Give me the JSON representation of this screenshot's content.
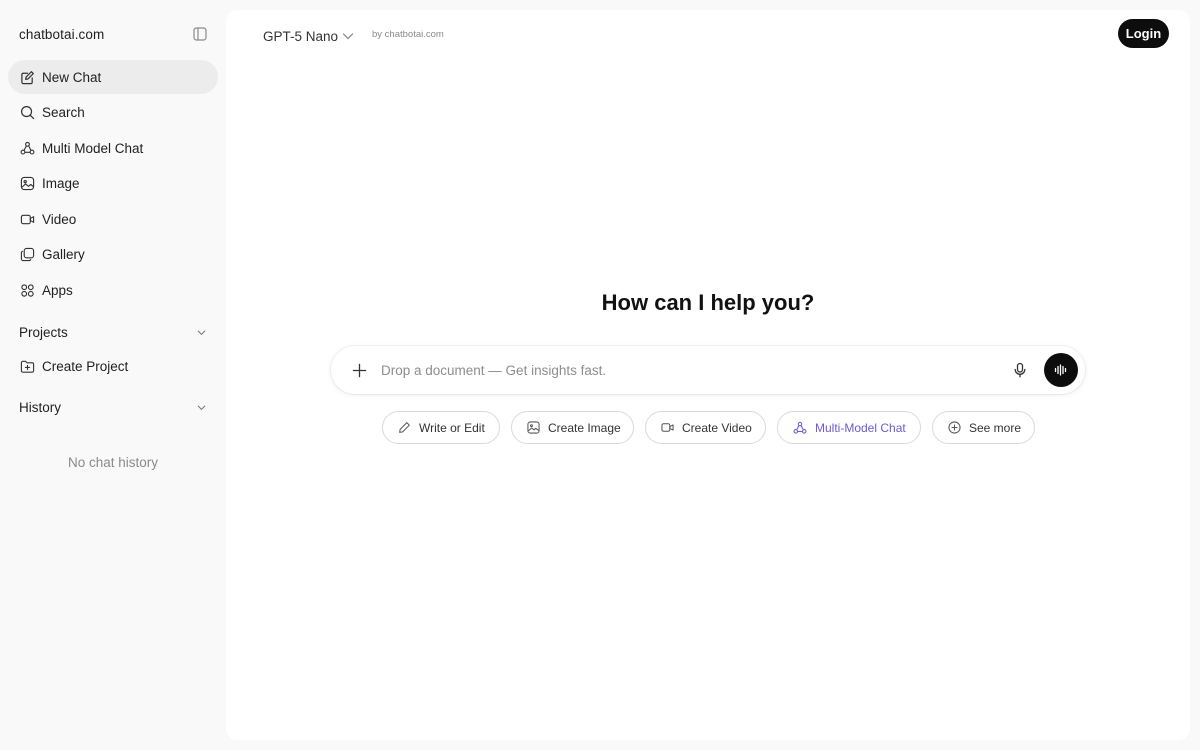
{
  "sidebar": {
    "brand": "chatbotai.com",
    "toggle_icon": "sidebar-toggle-icon",
    "items": [
      {
        "label": "New Chat",
        "icon": "edit-icon",
        "active": true
      },
      {
        "label": "Search",
        "icon": "search-icon"
      },
      {
        "label": "Multi Model Chat",
        "icon": "multi-model-icon"
      },
      {
        "label": "Image",
        "icon": "image-icon"
      },
      {
        "label": "Video",
        "icon": "video-icon"
      },
      {
        "label": "Gallery",
        "icon": "gallery-icon"
      },
      {
        "label": "Apps",
        "icon": "apps-icon"
      }
    ],
    "projects": {
      "title": "Projects",
      "create_label": "Create Project"
    },
    "history": {
      "title": "History",
      "empty_text": "No chat history"
    }
  },
  "header": {
    "model_name": "GPT-5 Nano",
    "model_by": "by chatbotai.com",
    "login_label": "Login"
  },
  "main": {
    "headline": "How can I help you?",
    "input_placeholder": "Drop a document — Get insights fast.",
    "chips": [
      {
        "label": "Write or Edit",
        "icon": "pencil-icon"
      },
      {
        "label": "Create Image",
        "icon": "image-icon"
      },
      {
        "label": "Create Video",
        "icon": "video-icon"
      },
      {
        "label": "Multi-Model Chat",
        "icon": "multi-model-icon",
        "accent": true
      },
      {
        "label": "See more",
        "icon": "plus-circle-icon"
      }
    ]
  },
  "colors": {
    "sidebar_bg": "#f9f9f9",
    "main_bg": "#ffffff",
    "active_item_bg": "#ececec",
    "primary_button": "#0d0d0d",
    "accent_text": "#6d5bd0"
  }
}
